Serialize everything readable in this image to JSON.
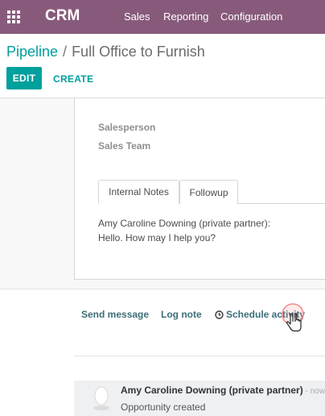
{
  "navbar": {
    "brand": "CRM",
    "menu": [
      "Sales",
      "Reporting",
      "Configuration"
    ]
  },
  "breadcrumb": {
    "parent": "Pipeline",
    "separator": "/",
    "current": "Full Office to Furnish"
  },
  "buttons": {
    "edit": "EDIT",
    "create": "CREATE"
  },
  "form": {
    "fields": {
      "salesperson": "Salesperson",
      "sales_team": "Sales Team"
    },
    "tabs": [
      "Internal Notes",
      "Followup"
    ],
    "notes": {
      "line1": "Amy Caroline Downing (private partner):",
      "line2": "Hello. How may I help you?"
    }
  },
  "chatter": {
    "send_message": "Send message",
    "log_note": "Log note",
    "schedule_activity": "Schedule activity",
    "message": {
      "author": "Amy Caroline Downing (private partner)",
      "time": " - now",
      "body": "Opportunity created"
    }
  },
  "colors": {
    "navbar": "#875a7b",
    "primary": "#00a09d",
    "chatter_link": "#3c6e79"
  },
  "icons": {
    "apps": "apps-grid-icon",
    "schedule": "clock-icon",
    "cursor": "hand-pointer-cursor",
    "avatar": "avatar-placeholder"
  }
}
